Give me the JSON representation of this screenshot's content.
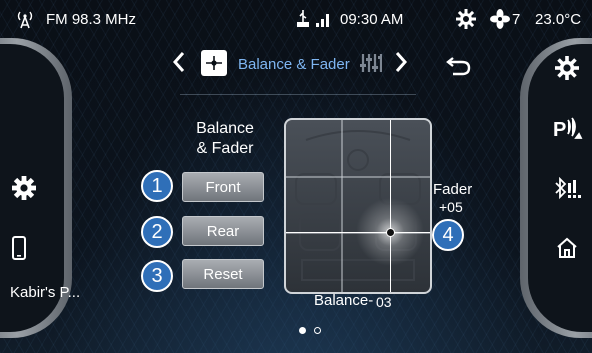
{
  "status_bar": {
    "radio": "FM 98.3 MHz",
    "time": "09:30 AM",
    "fan_speed": "7",
    "temperature": "23.0°C"
  },
  "nav": {
    "title": "Balance & Fader"
  },
  "controls": {
    "heading": "Balance\n& Fader",
    "front_label": "Front",
    "rear_label": "Rear",
    "reset_label": "Reset"
  },
  "badges": [
    "1",
    "2",
    "3",
    "4"
  ],
  "fader": {
    "label": "Fader",
    "value": "+05"
  },
  "balance": {
    "label": "Balance-",
    "value": "03"
  },
  "left_panel": {
    "device_name": "Kabir's P..."
  },
  "pager": {
    "current": 1,
    "total": 2
  },
  "colors": {
    "accent": "#7fb6f2",
    "badge": "#2f6fb8"
  }
}
